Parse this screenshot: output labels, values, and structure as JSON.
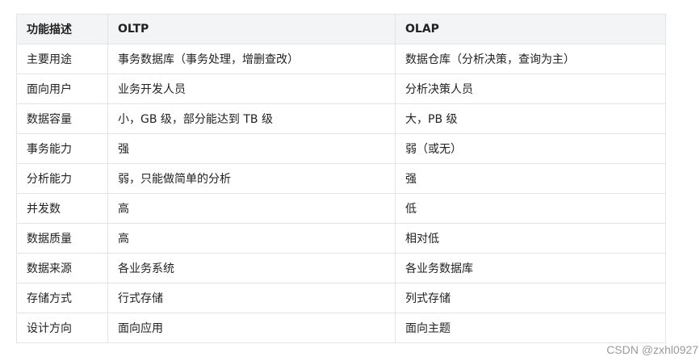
{
  "table": {
    "headers": [
      "功能描述",
      "OLTP",
      "OLAP"
    ],
    "rows": [
      [
        "主要用途",
        "事务数据库（事务处理，增删查改）",
        "数据仓库（分析决策，查询为主）"
      ],
      [
        "面向用户",
        "业务开发人员",
        "分析决策人员"
      ],
      [
        "数据容量",
        "小，GB 级，部分能达到 TB 级",
        "大，PB 级"
      ],
      [
        "事务能力",
        "强",
        "弱（或无）"
      ],
      [
        "分析能力",
        "弱，只能做简单的分析",
        "强"
      ],
      [
        "并发数",
        "高",
        "低"
      ],
      [
        "数据质量",
        "高",
        "相对低"
      ],
      [
        "数据来源",
        "各业务系统",
        "各业务数据库"
      ],
      [
        "存储方式",
        "行式存储",
        "列式存储"
      ],
      [
        "设计方向",
        "面向应用",
        "面向主题"
      ]
    ]
  },
  "watermark": "CSDN @zxhl0927"
}
